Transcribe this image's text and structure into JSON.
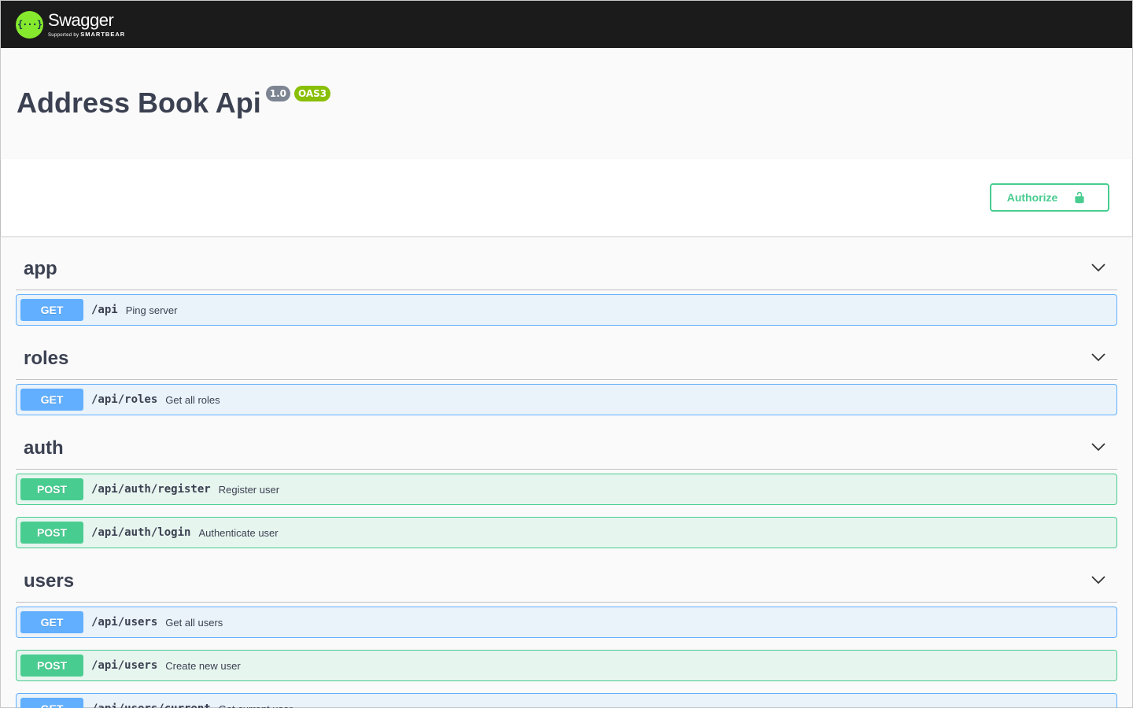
{
  "topbar": {
    "brand": "Swagger",
    "logo_glyph": "{···}",
    "supported_by": "Supported by",
    "company": "SMARTBEAR"
  },
  "info": {
    "title": "Address Book Api",
    "version": "1.0",
    "spec": "OAS3"
  },
  "scheme": {
    "authorize_label": "Authorize"
  },
  "colors": {
    "get": "#61affe",
    "post": "#49cc90",
    "topbar": "#1b1b1b",
    "logo": "#85ea2d"
  },
  "tags": [
    {
      "name": "app",
      "operations": [
        {
          "method": "GET",
          "path": "/api",
          "summary": "Ping server"
        }
      ]
    },
    {
      "name": "roles",
      "operations": [
        {
          "method": "GET",
          "path": "/api/roles",
          "summary": "Get all roles"
        }
      ]
    },
    {
      "name": "auth",
      "operations": [
        {
          "method": "POST",
          "path": "/api/auth/register",
          "summary": "Register user"
        },
        {
          "method": "POST",
          "path": "/api/auth/login",
          "summary": "Authenticate user"
        }
      ]
    },
    {
      "name": "users",
      "operations": [
        {
          "method": "GET",
          "path": "/api/users",
          "summary": "Get all users"
        },
        {
          "method": "POST",
          "path": "/api/users",
          "summary": "Create new user"
        },
        {
          "method": "GET",
          "path": "/api/users/current",
          "summary": "Get current user"
        }
      ]
    }
  ]
}
